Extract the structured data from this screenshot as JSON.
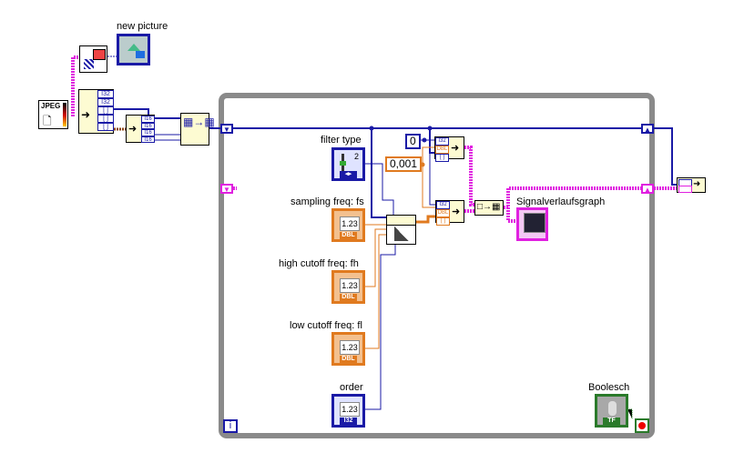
{
  "labels": {
    "new_picture": "new picture",
    "filter_type": "filter type",
    "sampling_freq": "sampling freq: fs",
    "high_cutoff": "high cutoff freq: fh",
    "low_cutoff": "low cutoff freq: fl",
    "order": "order",
    "graph": "Signalverlaufsgraph",
    "boolean": "Boolesch"
  },
  "constants": {
    "zero": "0",
    "dt": "0,001"
  },
  "controls": {
    "filter_type_value": "2",
    "numeric_display": "1.23",
    "dbl_tag": "DBL",
    "i32_tag": "I32",
    "bool_tag": "TF"
  },
  "jpeg_label": "JPEG",
  "loop_index": "i",
  "unbundle_terms": [
    "I32",
    "I32",
    "[ ]",
    "[ ]",
    "[ ]"
  ],
  "unbundle2_terms": [
    "I16",
    "I16",
    "I16",
    "I16"
  ],
  "bundle_terms": [
    "I32",
    "DBL",
    "[ ]"
  ],
  "colors": {
    "loop_border": "#8a8a8a",
    "int_wire": "#1a1aa6",
    "dbl_wire": "#e07a1f",
    "cluster_wire": "#e020e0",
    "bool_wire": "#007a00"
  }
}
